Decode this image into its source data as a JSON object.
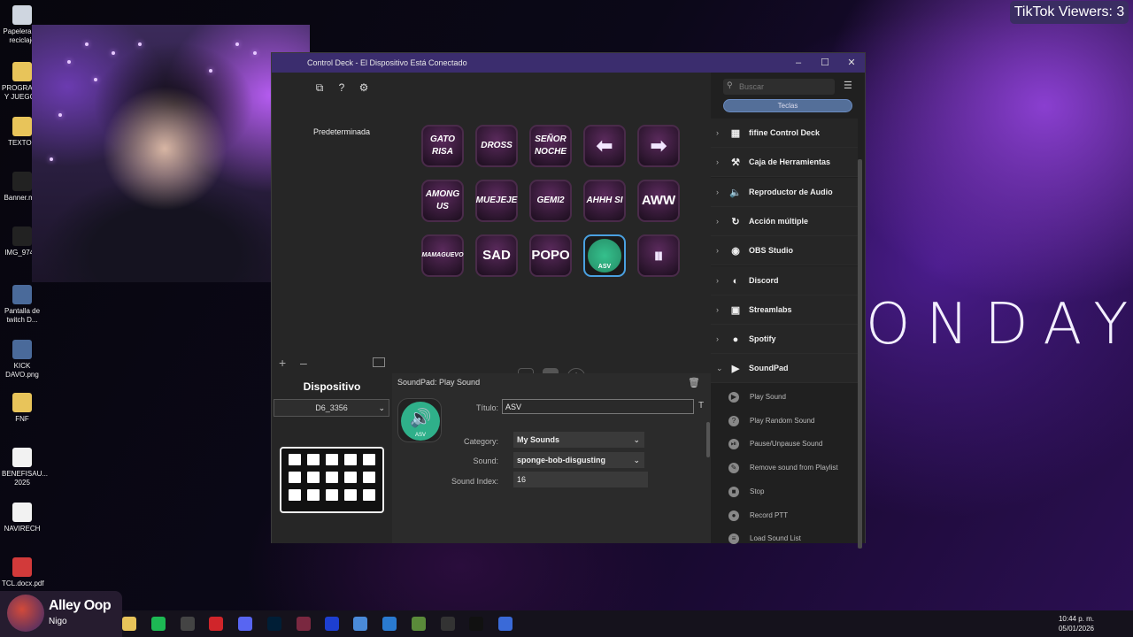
{
  "overlay": {
    "tiktok_viewers": "TikTok Viewers: 3",
    "brand_text": "ONDAY",
    "user_name": "Alley Oop",
    "user_sub": "Nigo"
  },
  "desktop_icons": [
    {
      "label": "Papelera de reciclaje",
      "icon": "recycle-bin-icon"
    },
    {
      "label": "PROGRAMAS Y JUEGOS",
      "icon": "folder-shortcut-icon"
    },
    {
      "label": "TEXTOS",
      "icon": "folder-shortcut-icon"
    },
    {
      "label": "Banner.m...",
      "icon": "video-file-icon"
    },
    {
      "label": "IMG_974...",
      "icon": "video-file-icon"
    },
    {
      "label": "Pantalla de twitch D...",
      "icon": "image-file-icon"
    },
    {
      "label": "KICK DAVO.png",
      "icon": "image-file-icon"
    },
    {
      "label": "FNF",
      "icon": "folder-icon"
    },
    {
      "label": "BENEFISAU... 2025",
      "icon": "document-icon"
    },
    {
      "label": "NAVIRECH",
      "icon": "document-icon"
    },
    {
      "label": "TCL.docx.pdf",
      "icon": "pdf-icon"
    }
  ],
  "window": {
    "title": "Control Deck - El Dispositivo Está Conectado",
    "minimize": "–",
    "maximize": "☐",
    "close": "✕",
    "profile": "Predeterminada",
    "toolbar": [
      "⧉",
      "?",
      "⚙"
    ],
    "keys": [
      {
        "label": "GATO RISA",
        "style": "italic"
      },
      {
        "label": "DROSS",
        "style": "italic"
      },
      {
        "label": "SEÑOR NOCHE",
        "style": "italic"
      },
      {
        "label": "⬅",
        "style": "arrow"
      },
      {
        "label": "➡",
        "style": "arrow"
      },
      {
        "label": "AMONG US",
        "style": "italic"
      },
      {
        "label": "MUEJEJE",
        "style": "italic"
      },
      {
        "label": "GEMI2",
        "style": "italic"
      },
      {
        "label": "AHHH SI",
        "style": "italic"
      },
      {
        "label": "AWW",
        "style": "big"
      },
      {
        "label": "MAMAGUEVO",
        "style": "small"
      },
      {
        "label": "SAD",
        "style": "big"
      },
      {
        "label": "POPO",
        "style": "big"
      },
      {
        "label": "ASV",
        "style": "sound"
      },
      {
        "label": "⏸",
        "style": "arrow"
      }
    ],
    "pages": [
      "1",
      "2",
      "+"
    ],
    "device": {
      "title": "Dispositivo",
      "selected": "D6_3356",
      "add": "+",
      "remove": "–"
    },
    "props": {
      "header": "SoundPad: Play Sound",
      "title_label": "Título:",
      "title_value": "ASV",
      "title_btn": "T",
      "icon_caption": "ASV",
      "category_label": "Category:",
      "category_value": "My Sounds",
      "sound_label": "Sound:",
      "sound_value": "sponge-bob-disgusting",
      "index_label": "Sound Index:",
      "index_value": "16"
    },
    "right": {
      "search_placeholder": "Buscar",
      "tab": "Teclas",
      "categories": [
        {
          "label": "fifine Control Deck",
          "icon": "grid-icon",
          "expanded": false
        },
        {
          "label": "Caja de Herramientas",
          "icon": "toolbox-icon",
          "expanded": false
        },
        {
          "label": "Reproductor de Audio",
          "icon": "speaker-icon",
          "expanded": false
        },
        {
          "label": "Acción múltiple",
          "icon": "multi-action-icon",
          "expanded": false
        },
        {
          "label": "OBS Studio",
          "icon": "obs-icon",
          "expanded": false
        },
        {
          "label": "Discord",
          "icon": "discord-icon",
          "expanded": false
        },
        {
          "label": "Streamlabs",
          "icon": "streamlabs-icon",
          "expanded": false
        },
        {
          "label": "Spotify",
          "icon": "spotify-icon",
          "expanded": false
        },
        {
          "label": "SoundPad",
          "icon": "soundpad-icon",
          "expanded": true
        }
      ],
      "actions": [
        "Play Sound",
        "Play Random Sound",
        "Pause/Unpause Sound",
        "Remove sound from Playlist",
        "Stop",
        "Record PTT",
        "Load Sound List"
      ]
    }
  },
  "taskbar": {
    "time": "10:44 p. m.",
    "date": "05/01/2026"
  },
  "colors": {
    "titlebar": "#3b2d6e",
    "accent": "#546f99",
    "key_border": "#4a2b4a"
  }
}
